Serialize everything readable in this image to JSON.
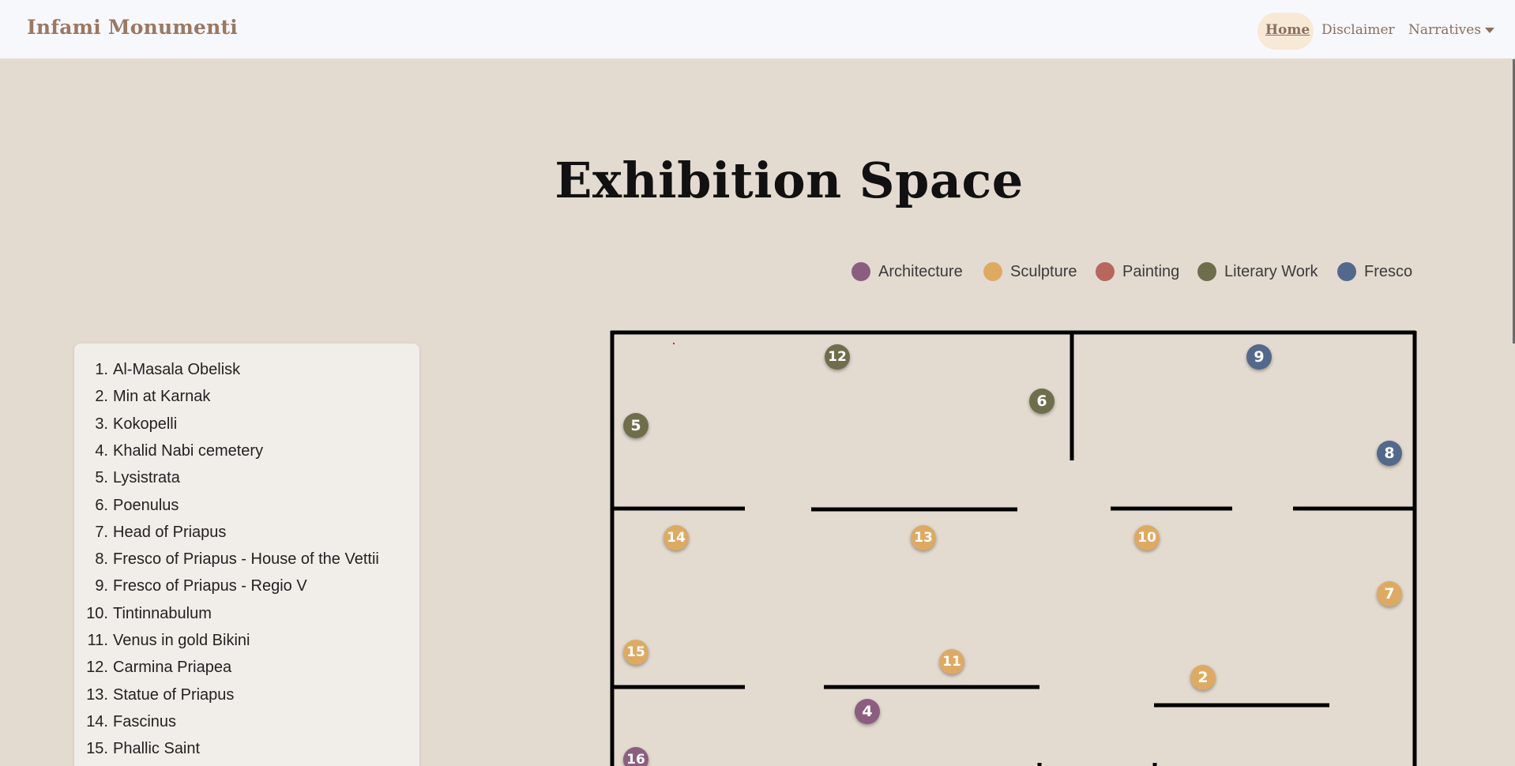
{
  "navbar": {
    "brand": "Infami Monumenti",
    "links": [
      "Home",
      "Disclaimer",
      "Narratives"
    ]
  },
  "page_title": "Exhibition Space",
  "legend": [
    {
      "label": "Architecture",
      "color": "#8b5e80"
    },
    {
      "label": "Sculpture",
      "color": "#deaa62"
    },
    {
      "label": "Painting",
      "color": "#b8675f"
    },
    {
      "label": "Literary Work",
      "color": "#6e6e4b"
    },
    {
      "label": "Fresco",
      "color": "#52698b"
    }
  ],
  "exhibits": [
    {
      "num": "1.",
      "name": "Al-Masala Obelisk"
    },
    {
      "num": "2.",
      "name": "Min at Karnak"
    },
    {
      "num": "3.",
      "name": "Kokopelli"
    },
    {
      "num": "4.",
      "name": "Khalid Nabi cemetery"
    },
    {
      "num": "5.",
      "name": "Lysistrata"
    },
    {
      "num": "6.",
      "name": "Poenulus"
    },
    {
      "num": "7.",
      "name": "Head of Priapus"
    },
    {
      "num": "8.",
      "name": "Fresco of Priapus - House of the Vettii"
    },
    {
      "num": "9.",
      "name": "Fresco of Priapus - Regio V"
    },
    {
      "num": "10.",
      "name": "Tintinnabulum"
    },
    {
      "num": "11.",
      "name": "Venus in gold Bikini"
    },
    {
      "num": "12.",
      "name": "Carmina Priapea"
    },
    {
      "num": "13.",
      "name": "Statue of Priapus"
    },
    {
      "num": "14.",
      "name": "Fascinus"
    },
    {
      "num": "15.",
      "name": "Phallic Saint"
    }
  ],
  "markers": [
    {
      "label": "12",
      "category": "Literary Work"
    },
    {
      "label": "9",
      "category": "Fresco"
    },
    {
      "label": "6",
      "category": "Literary Work"
    },
    {
      "label": "5",
      "category": "Literary Work"
    },
    {
      "label": "8",
      "category": "Fresco"
    },
    {
      "label": "14",
      "category": "Sculpture"
    },
    {
      "label": "13",
      "category": "Sculpture"
    },
    {
      "label": "10",
      "category": "Sculpture"
    },
    {
      "label": "7",
      "category": "Sculpture"
    },
    {
      "label": "15",
      "category": "Sculpture"
    },
    {
      "label": "11",
      "category": "Sculpture"
    },
    {
      "label": "2",
      "category": "Sculpture"
    },
    {
      "label": "4",
      "category": "Architecture"
    },
    {
      "label": "16",
      "category": "Architecture"
    }
  ]
}
